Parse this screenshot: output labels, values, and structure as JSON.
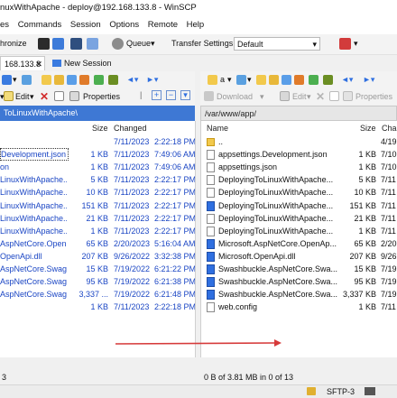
{
  "window": {
    "title": "nuxWithApache - deploy@192.168.133.8 - WinSCP"
  },
  "menu": [
    "es",
    "Commands",
    "Session",
    "Options",
    "Remote",
    "Help"
  ],
  "toolbar": {
    "synchronize": "hronize",
    "queue": "Queue",
    "transfer_settings": "Transfer Settings",
    "transfer_value": "Default"
  },
  "tabs": {
    "session": "168.133.8",
    "new_session": "New Session"
  },
  "left_tools": {
    "edit": "Edit",
    "properties": "Properties"
  },
  "right_tools": {
    "drive": "a",
    "download": "Download",
    "edit": "Edit",
    "properties": "Properties"
  },
  "left_panel": {
    "path": "ToLinuxWithApache\\",
    "headers": {
      "size": "Size",
      "changed": "Changed"
    },
    "rows": [
      {
        "name": "",
        "size": "",
        "date": "7/11/2023",
        "time": "2:22:18 PM"
      },
      {
        "name": "Development.json",
        "size": "1 KB",
        "date": "7/11/2023",
        "time": "7:49:06 AM"
      },
      {
        "name": "on",
        "size": "1 KB",
        "date": "7/11/2023",
        "time": "7:49:06 AM"
      },
      {
        "name": "LinuxWithApache...",
        "size": "5 KB",
        "date": "7/11/2023",
        "time": "2:22:17 PM"
      },
      {
        "name": "LinuxWithApache...",
        "size": "10 KB",
        "date": "7/11/2023",
        "time": "2:22:17 PM"
      },
      {
        "name": "LinuxWithApache...",
        "size": "151 KB",
        "date": "7/11/2023",
        "time": "2:22:17 PM"
      },
      {
        "name": "LinuxWithApache...",
        "size": "21 KB",
        "date": "7/11/2023",
        "time": "2:22:17 PM"
      },
      {
        "name": "LinuxWithApache...",
        "size": "1 KB",
        "date": "7/11/2023",
        "time": "2:22:17 PM"
      },
      {
        "name": "AspNetCore.Open...",
        "size": "65 KB",
        "date": "2/20/2023",
        "time": "5:16:04 AM"
      },
      {
        "name": "OpenApi.dll",
        "size": "207 KB",
        "date": "9/26/2022",
        "time": "3:32:38 PM"
      },
      {
        "name": "AspNetCore.Swag...",
        "size": "15 KB",
        "date": "7/19/2022",
        "time": "6:21:22 PM"
      },
      {
        "name": "AspNetCore.Swag...",
        "size": "95 KB",
        "date": "7/19/2022",
        "time": "6:21:38 PM"
      },
      {
        "name": "AspNetCore.Swag...",
        "size": "3,337 ...",
        "date": "7/19/2022",
        "time": "6:21:48 PM"
      },
      {
        "name": "",
        "size": "1 KB",
        "date": "7/11/2023",
        "time": "2:22:18 PM"
      }
    ],
    "status": "3"
  },
  "right_panel": {
    "path": "/var/www/app/",
    "headers": {
      "name": "Name",
      "size": "Size",
      "changed": "Cha"
    },
    "rows": [
      {
        "name": "..",
        "size": "",
        "changed": "4/19",
        "icon": "folder"
      },
      {
        "name": "appsettings.Development.json",
        "size": "1 KB",
        "changed": "7/10",
        "icon": "file"
      },
      {
        "name": "appsettings.json",
        "size": "1 KB",
        "changed": "7/10",
        "icon": "file"
      },
      {
        "name": "DeployingToLinuxWithApache...",
        "size": "5 KB",
        "changed": "7/11",
        "icon": "file"
      },
      {
        "name": "DeployingToLinuxWithApache...",
        "size": "10 KB",
        "changed": "7/11",
        "icon": "file"
      },
      {
        "name": "DeployingToLinuxWithApache...",
        "size": "151 KB",
        "changed": "7/11",
        "icon": "app"
      },
      {
        "name": "DeployingToLinuxWithApache...",
        "size": "21 KB",
        "changed": "7/11",
        "icon": "file"
      },
      {
        "name": "DeployingToLinuxWithApache...",
        "size": "1 KB",
        "changed": "7/11",
        "icon": "file"
      },
      {
        "name": "Microsoft.AspNetCore.OpenAp...",
        "size": "65 KB",
        "changed": "2/20",
        "icon": "app"
      },
      {
        "name": "Microsoft.OpenApi.dll",
        "size": "207 KB",
        "changed": "9/26",
        "icon": "app"
      },
      {
        "name": "Swashbuckle.AspNetCore.Swa...",
        "size": "15 KB",
        "changed": "7/19",
        "icon": "app"
      },
      {
        "name": "Swashbuckle.AspNetCore.Swa...",
        "size": "95 KB",
        "changed": "7/19",
        "icon": "app"
      },
      {
        "name": "Swashbuckle.AspNetCore.Swa...",
        "size": "3,337 KB",
        "changed": "7/19",
        "icon": "app"
      },
      {
        "name": "web.config",
        "size": "1 KB",
        "changed": "7/11",
        "icon": "file"
      }
    ],
    "status": "0 B of 3.81 MB in 0 of 13"
  },
  "bottom": {
    "protocol": "SFTP-3"
  },
  "colors": {
    "accent_path": "#3e78d4",
    "link_text": "#1b46c4",
    "drag_arrow": "#d63a3a"
  }
}
